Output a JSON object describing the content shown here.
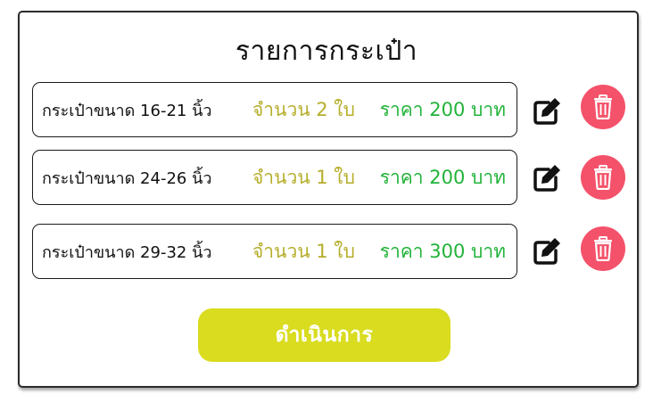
{
  "page": {
    "title": "รายการกระเป๋า"
  },
  "colors": {
    "quantity_text": "#b5ae2a",
    "price_text": "#22b33a",
    "delete_button_bg": "#f4526a",
    "proceed_button_bg": "#d9dc1f",
    "border": "#1a1a1a"
  },
  "items": [
    {
      "name": "กระเป๋าขนาด 16-21 นิ้ว",
      "quantity": "จำนวน 2 ใบ",
      "price": "ราคา 200 บาท",
      "edit_icon": "edit-icon",
      "delete_icon": "trash-icon"
    },
    {
      "name": "กระเป๋าขนาด 24-26 นิ้ว",
      "quantity": "จำนวน 1 ใบ",
      "price": "ราคา 200 บาท",
      "edit_icon": "edit-icon",
      "delete_icon": "trash-icon"
    },
    {
      "name": "กระเป๋าขนาด 29-32 นิ้ว",
      "quantity": "จำนวน 1 ใบ",
      "price": "ราคา 300 บาท",
      "edit_icon": "edit-icon",
      "delete_icon": "trash-icon"
    }
  ],
  "actions": {
    "proceed_label": "ดำเนินการ"
  }
}
